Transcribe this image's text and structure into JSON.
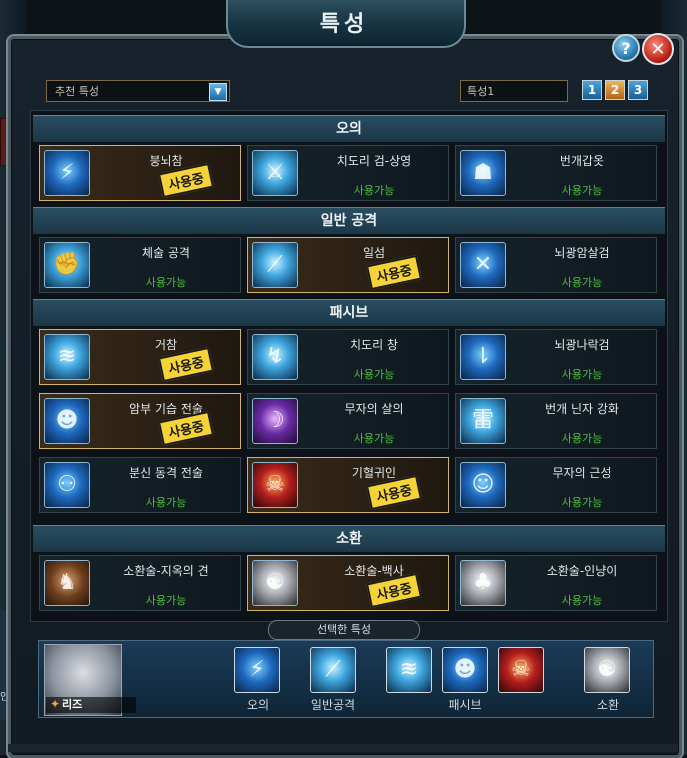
{
  "window": {
    "title": "특성",
    "help_glyph": "?",
    "close_glyph": "✕"
  },
  "left_edge_label": "인공",
  "toolbar": {
    "preset_select": "추천 특성",
    "preset_arrow": "▼",
    "preset_name": "특성1",
    "preset_buttons": [
      "1",
      "2",
      "3"
    ]
  },
  "categories": [
    {
      "label": "오의",
      "skills": [
        {
          "name": "붕뇌참",
          "status": "사용중",
          "active": true,
          "icon": "lightning-blade-icon",
          "tint": "blue"
        },
        {
          "name": "치도리 검-상영",
          "status": "사용가능",
          "active": false,
          "icon": "chidori-sword-icon",
          "tint": "cyan"
        },
        {
          "name": "번개갑옷",
          "status": "사용가능",
          "active": false,
          "icon": "lightning-armor-icon",
          "tint": "blue"
        }
      ]
    },
    {
      "label": "일반 공격",
      "skills": [
        {
          "name": "체술 공격",
          "status": "사용가능",
          "active": false,
          "icon": "fist-icon",
          "tint": "cyan"
        },
        {
          "name": "일섬",
          "status": "사용중",
          "active": true,
          "icon": "flash-slash-icon",
          "tint": "cyan"
        },
        {
          "name": "뇌광암살검",
          "status": "사용가능",
          "active": false,
          "icon": "dual-blade-icon",
          "tint": "blue"
        }
      ]
    },
    {
      "label": "패시브",
      "skills": [
        {
          "name": "거참",
          "status": "사용중",
          "active": true,
          "icon": "heavy-slash-icon",
          "tint": "cyan"
        },
        {
          "name": "치도리 창",
          "status": "사용가능",
          "active": false,
          "icon": "chidori-spear-icon",
          "tint": "cyan"
        },
        {
          "name": "뇌광나락검",
          "status": "사용가능",
          "active": false,
          "icon": "falling-blade-icon",
          "tint": "blue"
        },
        {
          "name": "암부 기습 전술",
          "status": "사용중",
          "active": true,
          "icon": "anbu-ambush-icon",
          "tint": "blue"
        },
        {
          "name": "무자의 살의",
          "status": "사용가능",
          "active": false,
          "icon": "killing-intent-icon",
          "tint": "violet"
        },
        {
          "name": "번개 닌자 강화",
          "status": "사용가능",
          "active": false,
          "icon": "thunder-kanji-icon",
          "tint": "cyan"
        },
        {
          "name": "분신 동격 전술",
          "status": "사용가능",
          "active": false,
          "icon": "clone-icon",
          "tint": "blue"
        },
        {
          "name": "기혈귀인",
          "status": "사용중",
          "active": true,
          "icon": "demon-face-icon",
          "tint": "red"
        },
        {
          "name": "무자의 근성",
          "status": "사용가능",
          "active": false,
          "icon": "silhouette-icon",
          "tint": "blue"
        }
      ]
    },
    {
      "label": "소환",
      "skills": [
        {
          "name": "소환술-지옥의 견",
          "status": "사용가능",
          "active": false,
          "icon": "hell-hound-icon",
          "tint": "brown"
        },
        {
          "name": "소환술-백사",
          "status": "사용중",
          "active": true,
          "icon": "white-snake-icon",
          "tint": "white"
        },
        {
          "name": "소환술-인냥이",
          "status": "사용가능",
          "active": false,
          "icon": "cat-icon",
          "tint": "white"
        }
      ]
    }
  ],
  "selected": {
    "label": "선택한 특성",
    "player_name": "리즈",
    "player_icon": "shuriken-icon",
    "groups": [
      {
        "label": "오의",
        "icons": [
          "lightning-blade-icon"
        ],
        "tints": [
          "blue"
        ]
      },
      {
        "label": "일반공격",
        "icons": [
          "flash-slash-icon"
        ],
        "tints": [
          "cyan"
        ]
      },
      {
        "label": "패시브",
        "icons": [
          "heavy-slash-icon",
          "anbu-ambush-icon",
          "demon-face-icon"
        ],
        "tints": [
          "cyan",
          "blue",
          "red"
        ]
      },
      {
        "label": "소환",
        "icons": [
          "white-snake-icon"
        ],
        "tints": [
          "white"
        ]
      }
    ]
  },
  "colors": {
    "active_badge": "#f7d33a",
    "available_text": "#4fbf3f",
    "active_border": "#d3b26c"
  }
}
